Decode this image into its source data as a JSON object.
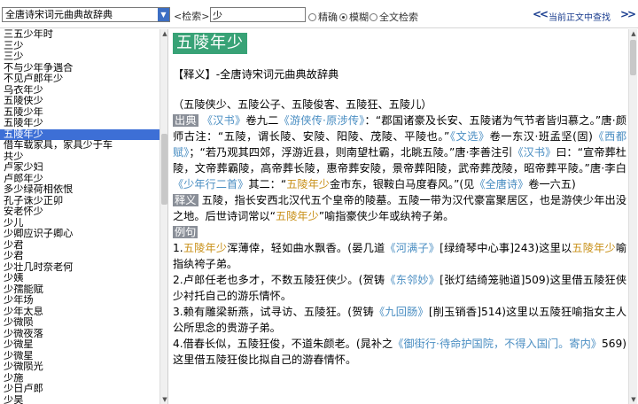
{
  "toolbar": {
    "dict_select": "全唐诗宋词元曲典故辞典",
    "search_label": "<检索>",
    "search_value": "少",
    "radio_exact": "精确",
    "radio_fuzzy": "模糊",
    "radio_fulltext": "全文检索",
    "nav_prev": "<<",
    "find_in_current": "当前正文中查找",
    "nav_next": ">>"
  },
  "word_list": [
    "三五少年时",
    "三少",
    "三少",
    "不与少年争遇合",
    "不见卢郎年少",
    "乌衣年少",
    "五陵侠少",
    "五陵少年",
    "五陵年少",
    "五陵年少",
    "借车载家具，家具少于车",
    "共少",
    "卢家少妇",
    "卢郎年少",
    "多少绿荷相依恨",
    "孔子诛少正卯",
    "安老怀少",
    "少儿",
    "少卿应识子卿心",
    "少君",
    "少君",
    "少壮几时奈老何",
    "少姨",
    "少孺能赋",
    "少年场",
    "少年太息",
    "少微陨",
    "少微夜落",
    "少微星",
    "少微星",
    "少微陨光",
    "少施",
    "少日卢郎",
    "少昊"
  ],
  "selected_index": 9,
  "entry": {
    "headword": "五陵年少",
    "definition_label": "【释义】",
    "definition_source": "-全唐诗宋词元曲典故辞典",
    "variants": "（五陵侠少、五陵公子、五陵俊客、五陵狂、五陵儿）",
    "p1": [
      {
        "t": "出典",
        "c": "tag"
      },
      {
        "t": " "
      },
      {
        "t": "《汉书》",
        "c": "link"
      },
      {
        "t": "卷九二"
      },
      {
        "t": "《游侠传·原涉传》",
        "c": "link"
      },
      {
        "t": "：“郡国诸豪及长安、五陵诸为气节者皆归慕之。”唐·颜师古注：“五陵，谓长陵、安陵、阳陵、茂陵、平陵也。”"
      },
      {
        "t": "《文选》",
        "c": "link"
      },
      {
        "t": "卷一东汉·班孟坚(固)"
      },
      {
        "t": "《西都赋》",
        "c": "link"
      },
      {
        "t": "；“若乃观其四郊，浮游近县，则南望杜霸，北眺五陵。”唐·李善注引"
      },
      {
        "t": "《汉书》",
        "c": "link"
      },
      {
        "t": "曰：“宣帝葬杜陵，文帝葬霸陵，高帝葬长陵，惠帝葬安陵，景帝葬阳陵，武帝葬茂陵，昭帝葬平陵。”唐·李白"
      },
      {
        "t": "《少年行二首》",
        "c": "link"
      },
      {
        "t": "其二：“"
      },
      {
        "t": "五陵年少",
        "c": "hl"
      },
      {
        "t": "金市东，银鞍白马度春风。”(见"
      },
      {
        "t": "《全唐诗》",
        "c": "link"
      },
      {
        "t": "卷一六五)"
      }
    ],
    "p2": [
      {
        "t": "释义",
        "c": "tag"
      },
      {
        "t": " 五陵，指长安西北汉代五个皇帝的陵墓。五陵一带为汉代豪富聚居区，也是游侠少年出没之地。后世诗词常以“"
      },
      {
        "t": "五陵年少",
        "c": "hl"
      },
      {
        "t": "”喻指豪侠少年或纨袴子弟。"
      }
    ],
    "examples_label": "例句",
    "ex1": [
      {
        "t": "1."
      },
      {
        "t": "五陵年少",
        "c": "hl"
      },
      {
        "t": "浑薄倖，轻如曲水飘香。(晏几道"
      },
      {
        "t": "《河满子》",
        "c": "link"
      },
      {
        "t": "[绿绮琴中心事]243)这里以"
      },
      {
        "t": "五陵年少",
        "c": "hl"
      },
      {
        "t": "喻指纨袴子弟。"
      }
    ],
    "ex2": [
      {
        "t": "2.卢郎任老也多才，不数五陵狂侠少。(贺铸"
      },
      {
        "t": "《东邻妙》",
        "c": "link"
      },
      {
        "t": "[张灯结绮笼驰道]509)这里借五陵狂侠少衬托自己的游乐情怀。"
      }
    ],
    "ex3": [
      {
        "t": "3.赖有雕梁新燕，试寻访、五陵狂。(贺铸"
      },
      {
        "t": "《九回肠》",
        "c": "link"
      },
      {
        "t": "[削玉销香]514)这里以五陵狂喻指女主人公所思念的贵游子弟。"
      }
    ],
    "ex4": [
      {
        "t": "4.借春长似，五陵狂俊，不道朱颜老。(晁补之"
      },
      {
        "t": "《御街行·待命护国院，不得入国门。寄内》",
        "c": "link"
      },
      {
        "t": "569)这里借五陵狂俊比拟自己的游春情怀。"
      }
    ]
  }
}
